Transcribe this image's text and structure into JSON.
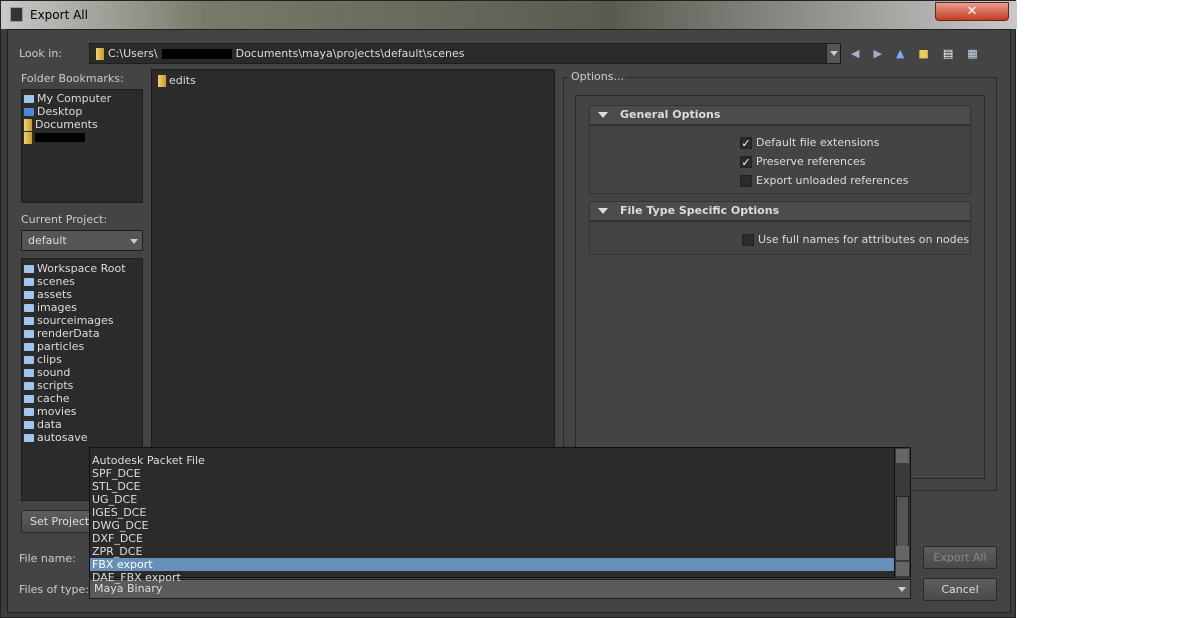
{
  "window": {
    "title": "Export All",
    "close_icon": "close-icon"
  },
  "look_in": {
    "label": "Look in:",
    "path": "C:\\Users\\",
    "path_rest": "Documents\\maya\\projects\\default\\scenes"
  },
  "bookmarks": {
    "label": "Folder Bookmarks:",
    "items": [
      "My Computer",
      "Desktop",
      "Documents"
    ]
  },
  "current_project": {
    "label": "Current Project:",
    "value": "default"
  },
  "project_folders": [
    "Workspace Root",
    "scenes",
    "assets",
    "images",
    "sourceimages",
    "renderData",
    "particles",
    "clips",
    "sound",
    "scripts",
    "cache",
    "movies",
    "data",
    "autosave"
  ],
  "set_project_label": "Set Project",
  "files": [
    "edits"
  ],
  "options": {
    "label": "Options...",
    "general": {
      "title": "General Options",
      "items": [
        {
          "label": "Default file extensions",
          "checked": true
        },
        {
          "label": "Preserve references",
          "checked": true
        },
        {
          "label": "Export unloaded references",
          "checked": false
        }
      ]
    },
    "filetype": {
      "title": "File Type Specific Options",
      "items": [
        {
          "label": "Use full names for attributes on nodes",
          "checked": false
        }
      ]
    }
  },
  "file_name_label": "File name:",
  "files_of_type": {
    "label": "Files of type:",
    "value": "Maya Binary",
    "options": [
      "Autodesk Packet File",
      "SPF_DCE",
      "STL_DCE",
      "UG_DCE",
      "IGES_DCE",
      "DWG_DCE",
      "DXF_DCE",
      "ZPR_DCE",
      "FBX export",
      "DAE_FBX export"
    ],
    "selected": "FBX export"
  },
  "buttons": {
    "export": "Export All",
    "cancel": "Cancel"
  },
  "colors": {
    "selection": "#6790b8",
    "background": "#444444"
  }
}
